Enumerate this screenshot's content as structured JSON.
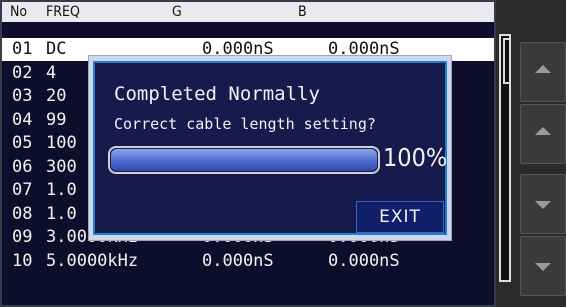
{
  "table": {
    "headers": {
      "no": "No",
      "freq": "FREQ",
      "g": "G",
      "b": "B"
    },
    "rows": [
      {
        "no": "01",
        "freq": "DC",
        "g": "0.000nS",
        "b": "0.000nS"
      },
      {
        "no": "02",
        "freq": "4",
        "g": "",
        "b": ""
      },
      {
        "no": "03",
        "freq": "20",
        "g": "",
        "b": ""
      },
      {
        "no": "04",
        "freq": "99",
        "g": "",
        "b": ""
      },
      {
        "no": "05",
        "freq": "100",
        "g": "",
        "b": ""
      },
      {
        "no": "06",
        "freq": "300",
        "g": "",
        "b": ""
      },
      {
        "no": "07",
        "freq": "1.0",
        "g": "",
        "b": ""
      },
      {
        "no": "08",
        "freq": "1.0",
        "g": "",
        "b": ""
      },
      {
        "no": "09",
        "freq": "3.0000kHz",
        "g": "0.000nS",
        "b": "0.000nS"
      },
      {
        "no": "10",
        "freq": "5.0000kHz",
        "g": "0.000nS",
        "b": "0.000nS"
      }
    ]
  },
  "dialog": {
    "title": "Completed Normally",
    "message": "Correct cable length setting?",
    "progress_percent": 100,
    "progress_label": "100%",
    "exit_label": "EXIT"
  },
  "sidebar": {
    "buttons": [
      "chevron-up-icon",
      "chevron-up-icon",
      "chevron-down-icon",
      "chevron-down-icon"
    ]
  },
  "colors": {
    "panel_bg": "#0e0e2c",
    "dialog_bg": "#161a4c",
    "dialog_border": "#1d7fc9",
    "progress_fill": "#4d6bd1"
  }
}
